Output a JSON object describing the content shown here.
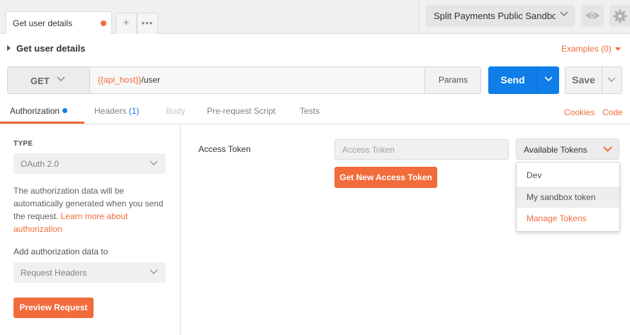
{
  "tabs": [
    {
      "label": "Get user details",
      "unsaved": true
    }
  ],
  "environment": {
    "selected": "Split Payments Public Sandbox"
  },
  "request": {
    "title": "Get user details",
    "examples_label": "Examples (0)",
    "method": "GET",
    "url_variable": "{{api_host}}",
    "url_path": "/user",
    "params_label": "Params",
    "send_label": "Send",
    "save_label": "Save"
  },
  "section_tabs": {
    "authorization": "Authorization",
    "headers": "Headers",
    "headers_count": "(1)",
    "body": "Body",
    "prerequest": "Pre-request Script",
    "tests": "Tests",
    "cookies": "Cookies",
    "code": "Code"
  },
  "auth": {
    "type_label": "TYPE",
    "type_value": "OAuth 2.0",
    "description": "The authorization data will be automatically generated when you send the request.",
    "learn_more": "Learn more about authorization",
    "add_to_label": "Add authorization data to",
    "add_to_value": "Request Headers",
    "preview_label": "Preview Request"
  },
  "token": {
    "label": "Access Token",
    "placeholder": "Access Token",
    "get_new_label": "Get New Access Token",
    "available_label": "Available Tokens",
    "menu": [
      "Dev",
      "My sandbox token",
      "Manage Tokens"
    ]
  },
  "colors": {
    "accent": "#f26b3a",
    "primary": "#0f7ee8"
  }
}
